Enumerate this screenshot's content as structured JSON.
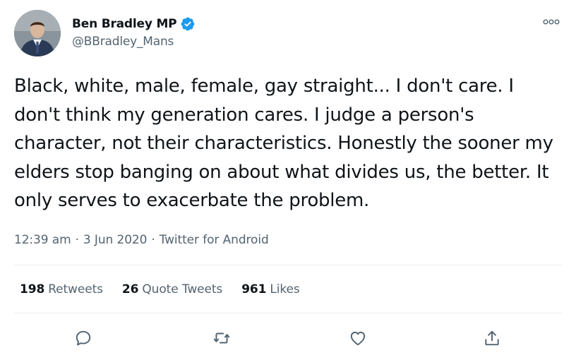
{
  "author": {
    "display_name": "Ben Bradley MP",
    "handle": "@BBradley_Mans",
    "verified": true
  },
  "tweet": {
    "text": "Black, white, male, female, gay straight... I don't care. I don't think my generation cares. I judge a person's character, not their characteristics. Honestly the sooner my elders stop banging on about what divides us, the better. It only serves to exacerbate the problem."
  },
  "meta": {
    "time": "12:39 am",
    "separator": "·",
    "date": "3 Jun 2020",
    "source": "Twitter for Android"
  },
  "stats": {
    "retweets_count": "198",
    "retweets_label": "Retweets",
    "quotes_count": "26",
    "quotes_label": "Quote Tweets",
    "likes_count": "961",
    "likes_label": "Likes"
  },
  "icons": {
    "verified": "verified-badge-icon",
    "more": "more-icon",
    "reply": "reply-icon",
    "retweet": "retweet-icon",
    "like": "heart-icon",
    "share": "share-icon"
  },
  "colors": {
    "verified": "#1d9bf0",
    "secondary_text": "#536471",
    "primary_text": "#0f1419",
    "divider": "#e6ecf0"
  }
}
